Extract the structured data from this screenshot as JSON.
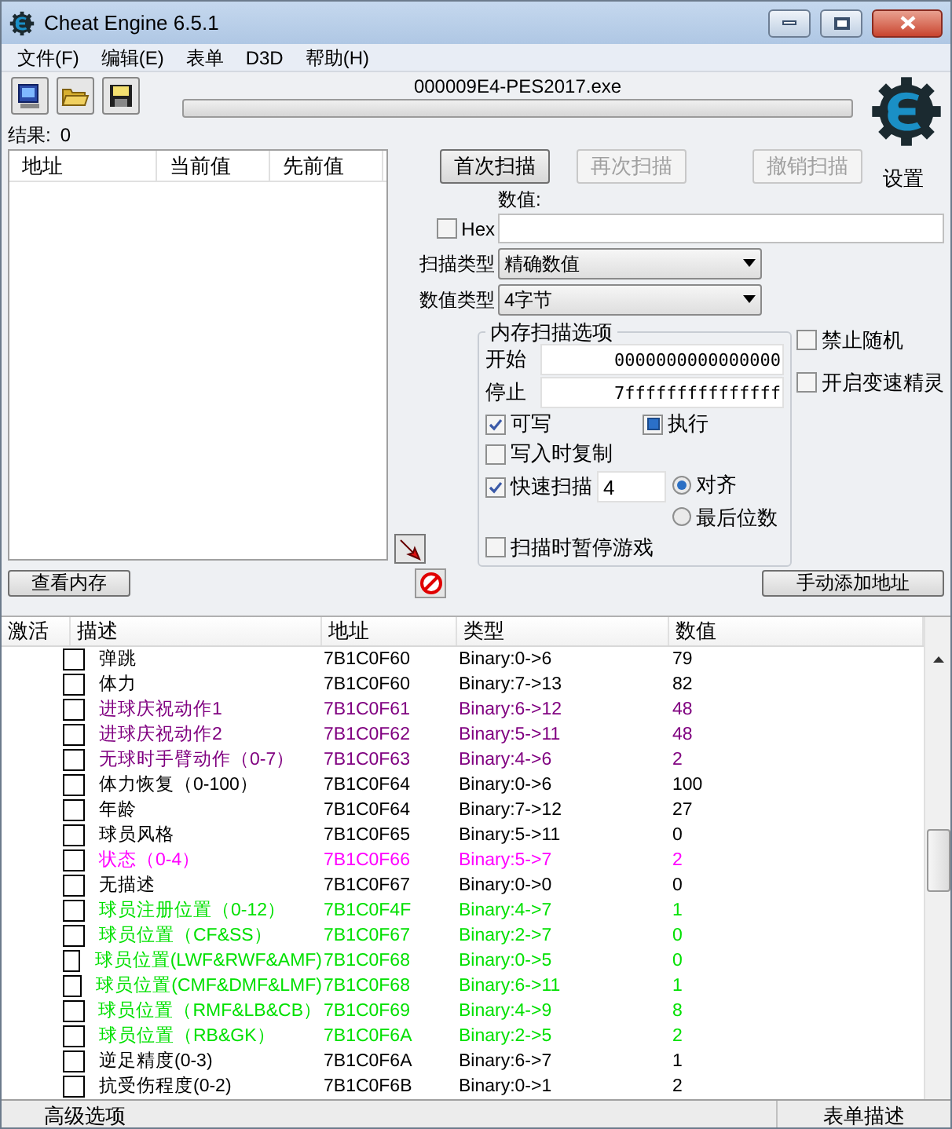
{
  "window": {
    "title": "Cheat Engine 6.5.1"
  },
  "menu": [
    "文件(F)",
    "编辑(E)",
    "表单",
    "D3D",
    "帮助(H)"
  ],
  "process": "000009E4-PES2017.exe",
  "progress": {
    "level": 0
  },
  "results": {
    "label": "结果:",
    "count": "0"
  },
  "found_list": {
    "columns": [
      "地址",
      "当前值",
      "先前值"
    ]
  },
  "scan_buttons": [
    {
      "label": "首次扫描",
      "disabled": false
    },
    {
      "label": "再次扫描",
      "disabled": true
    },
    {
      "label": "撤销扫描",
      "disabled": true
    }
  ],
  "settings_label": "设置",
  "value": {
    "label": "数值:",
    "hex": {
      "label": "Hex",
      "checked": false
    }
  },
  "scan_type": {
    "label": "扫描类型",
    "value": "精确数值"
  },
  "value_type": {
    "label": "数值类型",
    "value": "4字节"
  },
  "memory_options": {
    "title": "内存扫描选项",
    "start_label": "开始",
    "start": "0000000000000000",
    "stop_label": "停止",
    "stop": "7fffffffffffffff",
    "writable": {
      "label": "可写",
      "checked": true
    },
    "executable": {
      "label": "执行",
      "checked": true,
      "mixed": true
    },
    "copy_on_write": {
      "label": "写入时复制",
      "checked": false
    },
    "fast_scan": {
      "label": "快速扫描",
      "checked": true,
      "value": "4"
    },
    "alignment": [
      {
        "label": "对齐",
        "selected": true
      },
      {
        "label": "最后位数",
        "selected": false
      }
    ],
    "pause": {
      "label": "扫描时暂停游戏",
      "checked": false
    }
  },
  "extra_options": [
    {
      "label": "禁止随机",
      "checked": false
    },
    {
      "label": "开启变速精灵",
      "checked": false
    }
  ],
  "buttons": {
    "memory_view": "查看内存",
    "add_address": "手动添加地址"
  },
  "table": {
    "columns": [
      "激活",
      "描述",
      "地址",
      "类型",
      "数值"
    ],
    "rows": [
      {
        "active": false,
        "description": "弹跳",
        "address": "7B1C0F60",
        "type": "Binary:0->6",
        "value": "79",
        "color": "#000000"
      },
      {
        "active": false,
        "description": "体力",
        "address": "7B1C0F60",
        "type": "Binary:7->13",
        "value": "82",
        "color": "#000000"
      },
      {
        "active": false,
        "description": "进球庆祝动作1",
        "address": "7B1C0F61",
        "type": "Binary:6->12",
        "value": "48",
        "color": "#800080"
      },
      {
        "active": false,
        "description": "进球庆祝动作2",
        "address": "7B1C0F62",
        "type": "Binary:5->11",
        "value": "48",
        "color": "#800080"
      },
      {
        "active": false,
        "description": "无球时手臂动作（0-7）",
        "address": "7B1C0F63",
        "type": "Binary:4->6",
        "value": "2",
        "color": "#800080"
      },
      {
        "active": false,
        "description": "体力恢复（0-100）",
        "address": "7B1C0F64",
        "type": "Binary:0->6",
        "value": "100",
        "color": "#000000"
      },
      {
        "active": false,
        "description": "年龄",
        "address": "7B1C0F64",
        "type": "Binary:7->12",
        "value": "27",
        "color": "#000000"
      },
      {
        "active": false,
        "description": "球员风格",
        "address": "7B1C0F65",
        "type": "Binary:5->11",
        "value": "0",
        "color": "#000000"
      },
      {
        "active": false,
        "description": "状态（0-4）",
        "address": "7B1C0F66",
        "type": "Binary:5->7",
        "value": "2",
        "color": "#ff00ff"
      },
      {
        "active": false,
        "description": "无描述",
        "address": "7B1C0F67",
        "type": "Binary:0->0",
        "value": "0",
        "color": "#000000"
      },
      {
        "active": false,
        "description": "球员注册位置（0-12）",
        "address": "7B1C0F4F",
        "type": "Binary:4->7",
        "value": "1",
        "color": "#00e000"
      },
      {
        "active": false,
        "description": "球员位置（CF&SS）",
        "address": "7B1C0F67",
        "type": "Binary:2->7",
        "value": "0",
        "color": "#00e000"
      },
      {
        "active": false,
        "description": "球员位置(LWF&RWF&AMF)",
        "address": "7B1C0F68",
        "type": "Binary:0->5",
        "value": "0",
        "color": "#00e000"
      },
      {
        "active": false,
        "description": "球员位置(CMF&DMF&LMF)",
        "address": "7B1C0F68",
        "type": "Binary:6->11",
        "value": "1",
        "color": "#00e000"
      },
      {
        "active": false,
        "description": "球员位置（RMF&LB&CB）",
        "address": "7B1C0F69",
        "type": "Binary:4->9",
        "value": "8",
        "color": "#00e000"
      },
      {
        "active": false,
        "description": "球员位置（RB&GK）",
        "address": "7B1C0F6A",
        "type": "Binary:2->5",
        "value": "2",
        "color": "#00e000"
      },
      {
        "active": false,
        "description": "逆足精度(0-3)",
        "address": "7B1C0F6A",
        "type": "Binary:6->7",
        "value": "1",
        "color": "#000000"
      },
      {
        "active": false,
        "description": "抗受伤程度(0-2)",
        "address": "7B1C0F6B",
        "type": "Binary:0->1",
        "value": "2",
        "color": "#000000"
      }
    ]
  },
  "status_bar": {
    "advanced": "高级选项",
    "table_extras": "表单描述"
  }
}
